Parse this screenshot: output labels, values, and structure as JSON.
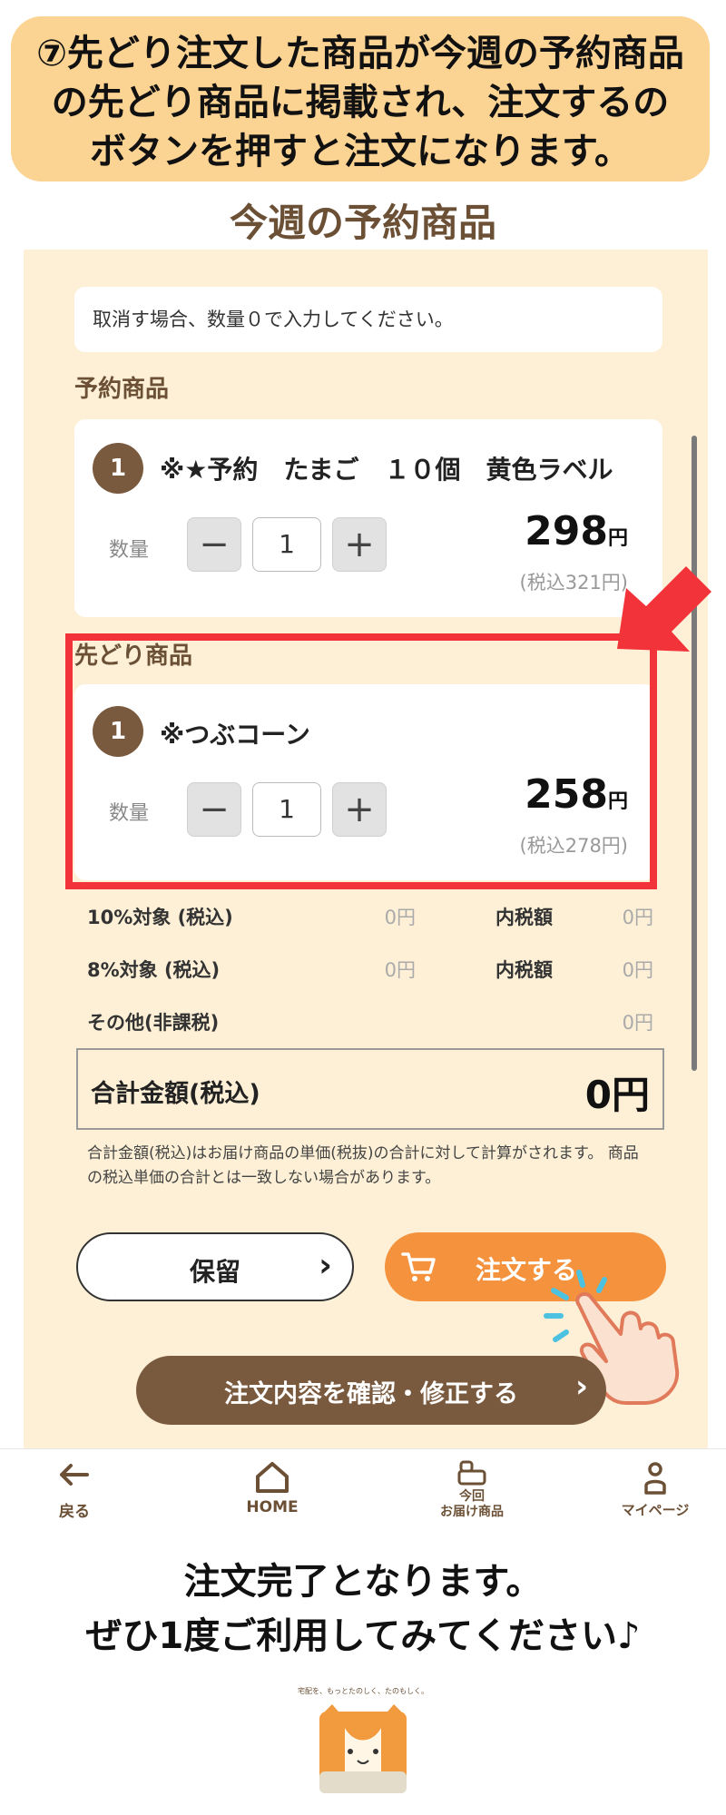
{
  "banner": {
    "line1": "⑦先どり注文した商品が今週の予約商品",
    "line2": "の先どり商品に掲載され、注文するの",
    "line3": "ボタンを押すと注文になります。"
  },
  "section_title": "今週の予約商品",
  "notice": "取消す場合、数量０で入力してください。",
  "reservation": {
    "heading": "予約商品",
    "items": [
      {
        "index": "1",
        "name": "※★予約　たまご　１０個　黄色ラベル",
        "qty_label": "数量",
        "qty": "1",
        "minus": "−",
        "plus": "+",
        "price": "298",
        "yen": "円",
        "tax_price": "(税込321円)"
      }
    ]
  },
  "advance": {
    "heading": "先どり商品",
    "items": [
      {
        "index": "1",
        "name": "※つぶコーン",
        "qty_label": "数量",
        "qty": "1",
        "minus": "−",
        "plus": "+",
        "price": "258",
        "yen": "円",
        "tax_price": "(税込278円)"
      }
    ]
  },
  "summary": {
    "rows": [
      {
        "label": "10%対象 (税込)",
        "value": "0円",
        "tax_label": "内税額",
        "tax_value": "0円"
      },
      {
        "label": "8%対象 (税込)",
        "value": "0円",
        "tax_label": "内税額",
        "tax_value": "0円"
      },
      {
        "label": "その他(非課税)",
        "value": "0円"
      }
    ],
    "total_label": "合計金額(税込)",
    "total_value": "0円",
    "note": "合計金額(税込)はお届け商品の単価(税抜)の合計に対して計算がされます。 商品の税込単価の合計とは一致しない場合があります。"
  },
  "buttons": {
    "hold": "保留",
    "order": "注文する",
    "confirm": "注文内容を確認・修正する"
  },
  "tabbar": {
    "back": "戻る",
    "home": "HOME",
    "delivery_line1": "今回",
    "delivery_line2": "お届け商品",
    "mypage": "マイページ"
  },
  "outro": {
    "line1": "注文完了となります。",
    "line2": "ぜひ1度ご利用してみてください♪"
  },
  "logo": {
    "tagline": "宅配を、もっとたのしく、たのもしく。",
    "icon": "cat-box-logo"
  },
  "colors": {
    "banner": "#fbd393",
    "panel": "#fdf0d6",
    "brown": "#7a5a3f",
    "orange": "#f5923e",
    "highlight_red": "#f2343a"
  }
}
